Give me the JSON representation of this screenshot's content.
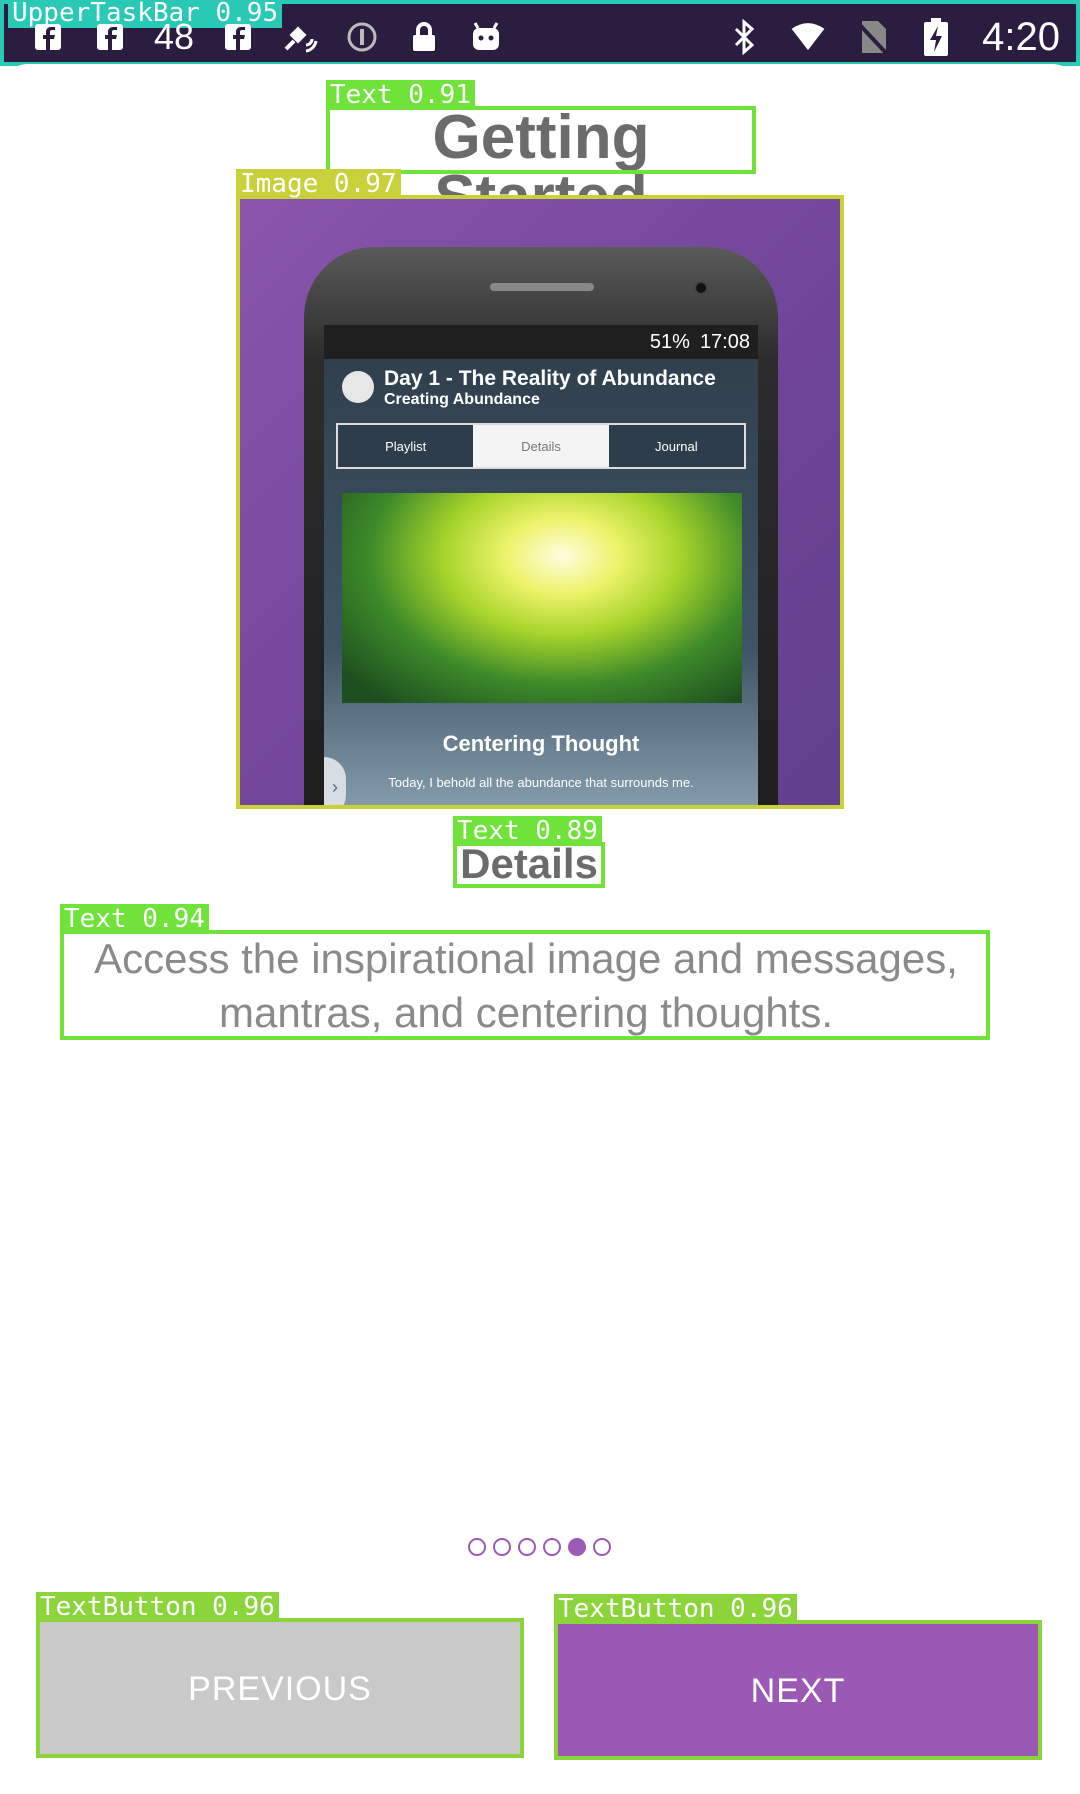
{
  "status_bar": {
    "label": "UpperTaskBar 0.95",
    "notification_count": "48",
    "clock": "4:20"
  },
  "labels": {
    "title": "Text 0.91",
    "image": "Image 0.97",
    "subtitle": "Text 0.89",
    "description": "Text 0.94",
    "previous": "TextButton 0.96",
    "next": "TextButton 0.96"
  },
  "page": {
    "title": "Getting Started",
    "subtitle": "Details",
    "description": "Access the inspirational image and messages, mantras, and centering thoughts."
  },
  "phone_mockup": {
    "status_battery": "51%",
    "status_time": "17:08",
    "heading": "Day 1 - The Reality of Abundance",
    "subheading": "Creating Abundance",
    "tabs": [
      "Playlist",
      "Details",
      "Journal"
    ],
    "centering_title": "Centering Thought",
    "centering_text": "Today, I behold all the abundance that surrounds me."
  },
  "pager": {
    "total": 6,
    "current_index": 4
  },
  "buttons": {
    "previous": "PREVIOUS",
    "next": "NEXT"
  },
  "colors": {
    "accent": "#9b59b6",
    "disabled": "#c9c9c9",
    "status_bar": "#2b1d3f"
  }
}
